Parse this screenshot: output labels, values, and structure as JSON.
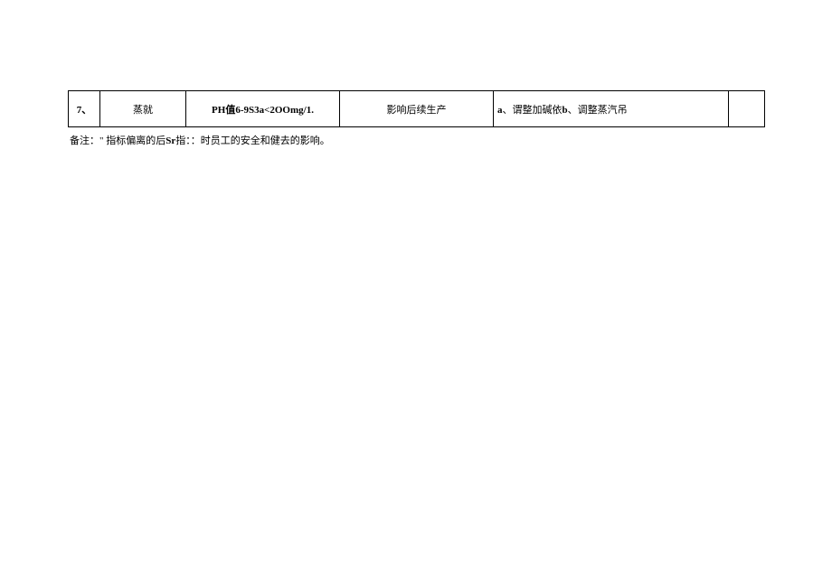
{
  "table": {
    "row": {
      "num": "7、",
      "col2": "蒸就",
      "col3": "PH值6-9S3a<2OOmg/1.",
      "col4": "影响后续生产",
      "col5_a": "a",
      "col5_text1": "、谓整加碱依",
      "col5_b": "b",
      "col5_text2": "、调整蒸汽吊",
      "col6": ""
    }
  },
  "footnote": {
    "prefix": "备注：\" 指标偏离的后",
    "bold": "Sr",
    "suffix": "指：：时员工的安全和健去的影响。"
  }
}
